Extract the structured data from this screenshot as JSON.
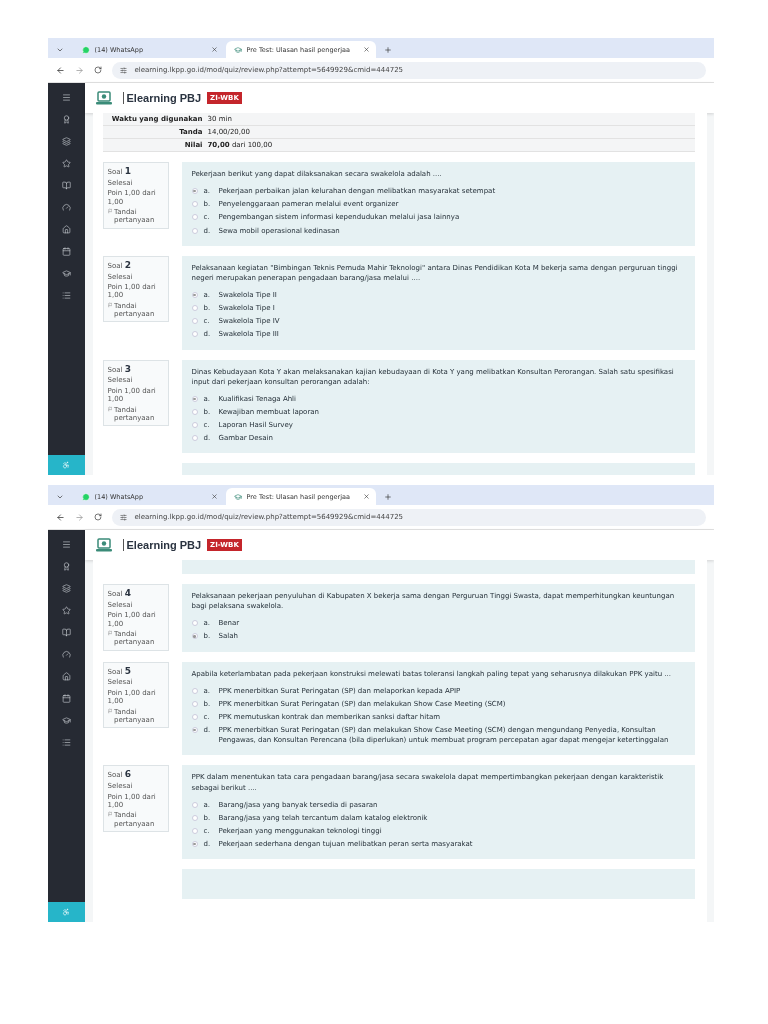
{
  "screenshots": [
    {
      "tabs": [
        {
          "title": "(14) WhatsApp",
          "kind": "whatsapp",
          "selected": false
        },
        {
          "title": "Pre Test: Ulasan hasil pengerjaa",
          "kind": "elearning",
          "selected": true
        }
      ],
      "url": "elearning.lkpp.go.id/mod/quiz/review.php?attempt=5649929&cmid=444725",
      "site": {
        "title": "Elearning PBJ",
        "badge": "ZI-WBK"
      },
      "summary": [
        {
          "label": "Waktu yang digunakan",
          "value": "30 min"
        },
        {
          "label": "Tanda",
          "value": "14,00/20,00"
        },
        {
          "label": "Nilai",
          "value": "**70,00** dari 100,00"
        }
      ],
      "questions": [
        {
          "label": "Soal",
          "number": "1",
          "status": "Selesai",
          "points": "Poin 1,00 dari 1,00",
          "flag": "Tandai pertanyaan",
          "text": "Pekerjaan berikut yang dapat dilaksanakan secara swakelola adalah ....",
          "options": [
            {
              "letter": "a.",
              "text": "Pekerjaan perbaikan jalan kelurahan dengan melibatkan masyarakat setempat",
              "selected": true
            },
            {
              "letter": "b.",
              "text": "Penyelenggaraan pameran melalui event organizer",
              "selected": false
            },
            {
              "letter": "c.",
              "text": "Pengembangan sistem informasi kependudukan melalui jasa lainnya",
              "selected": false
            },
            {
              "letter": "d.",
              "text": "Sewa mobil operasional kedinasan",
              "selected": false
            }
          ]
        },
        {
          "label": "Soal",
          "number": "2",
          "status": "Selesai",
          "points": "Poin 1,00 dari 1,00",
          "flag": "Tandai pertanyaan",
          "text": "Pelaksanaan kegiatan \"Bimbingan Teknis Pemuda Mahir Teknologi\" antara Dinas Pendidikan Kota M bekerja sama dengan perguruan tinggi negeri merupakan penerapan pengadaan barang/jasa melalui ....",
          "options": [
            {
              "letter": "a.",
              "text": "Swakelola Tipe II",
              "selected": true
            },
            {
              "letter": "b.",
              "text": "Swakelola Tipe I",
              "selected": false
            },
            {
              "letter": "c.",
              "text": "Swakelola Tipe IV",
              "selected": false
            },
            {
              "letter": "d.",
              "text": "Swakelola Tipe III",
              "selected": false
            }
          ]
        },
        {
          "label": "Soal",
          "number": "3",
          "status": "Selesai",
          "points": "Poin 1,00 dari 1,00",
          "flag": "Tandai pertanyaan",
          "text": "Dinas Kebudayaan Kota Y akan melaksanakan kajian kebudayaan di Kota Y yang melibatkan Konsultan Perorangan. Salah satu spesifikasi input dari pekerjaan konsultan perorangan adalah:",
          "options": [
            {
              "letter": "a.",
              "text": "Kualifikasi Tenaga Ahli",
              "selected": true
            },
            {
              "letter": "b.",
              "text": "Kewajiban membuat laporan",
              "selected": false
            },
            {
              "letter": "c.",
              "text": "Laporan Hasil Survey",
              "selected": false
            },
            {
              "letter": "d.",
              "text": "Gambar Desain",
              "selected": false
            }
          ]
        }
      ]
    },
    {
      "tabs": [
        {
          "title": "(14) WhatsApp",
          "kind": "whatsapp",
          "selected": false
        },
        {
          "title": "Pre Test: Ulasan hasil pengerjaa",
          "kind": "elearning",
          "selected": true
        }
      ],
      "url": "elearning.lkpp.go.id/mod/quiz/review.php?attempt=5649929&cmid=444725",
      "site": {
        "title": "Elearning PBJ",
        "badge": "ZI-WBK"
      },
      "questions": [
        {
          "label": "Soal",
          "number": "4",
          "status": "Selesai",
          "points": "Poin 1,00 dari 1,00",
          "flag": "Tandai pertanyaan",
          "text": "Pelaksanaan pekerjaan penyuluhan di Kabupaten X bekerja sama dengan Perguruan Tinggi Swasta, dapat memperhitungkan keuntungan bagi pelaksana swakelola.",
          "options": [
            {
              "letter": "a.",
              "text": "Benar",
              "selected": false
            },
            {
              "letter": "b.",
              "text": "Salah",
              "selected": true
            }
          ]
        },
        {
          "label": "Soal",
          "number": "5",
          "status": "Selesai",
          "points": "Poin 1,00 dari 1,00",
          "flag": "Tandai pertanyaan",
          "text": "Apabila keterlambatan pada pekerjaan konstruksi melewati batas toleransi langkah paling tepat yang seharusnya dilakukan PPK yaitu ...",
          "options": [
            {
              "letter": "a.",
              "text": "PPK menerbitkan Surat Peringatan (SP) dan melaporkan kepada APIP",
              "selected": false
            },
            {
              "letter": "b.",
              "text": "PPK menerbitkan Surat Peringatan (SP) dan melakukan Show Case Meeting (SCM)",
              "selected": false
            },
            {
              "letter": "c.",
              "text": "PPK memutuskan kontrak dan memberikan sanksi daftar hitam",
              "selected": false
            },
            {
              "letter": "d.",
              "text": "PPK menerbitkan Surat Peringatan (SP) dan melakukan Show Case Meeting (SCM) dengan mengundang Penyedia, Konsultan Pengawas, dan Konsultan Perencana (bila diperlukan) untuk membuat program percepatan agar dapat mengejar ketertinggalan",
              "selected": true
            }
          ]
        },
        {
          "label": "Soal",
          "number": "6",
          "status": "Selesai",
          "points": "Poin 1,00 dari 1,00",
          "flag": "Tandai pertanyaan",
          "text": "PPK dalam menentukan tata cara pengadaan barang/jasa secara swakelola dapat mempertimbangkan pekerjaan dengan karakteristik sebagai berikut ....",
          "options": [
            {
              "letter": "a.",
              "text": "Barang/jasa yang banyak tersedia di pasaran",
              "selected": false
            },
            {
              "letter": "b.",
              "text": "Barang/jasa yang telah tercantum dalam katalog elektronik",
              "selected": false
            },
            {
              "letter": "c.",
              "text": "Pekerjaan yang menggunakan teknologi tinggi",
              "selected": false
            },
            {
              "letter": "d.",
              "text": "Pekerjaan sederhana dengan tujuan melibatkan peran serta masyarakat",
              "selected": true
            }
          ]
        }
      ]
    }
  ]
}
